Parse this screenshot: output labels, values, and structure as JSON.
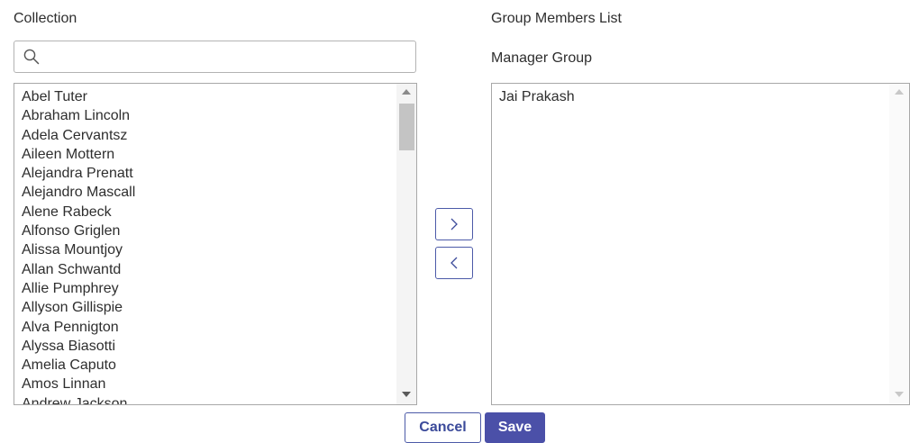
{
  "collection": {
    "heading": "Collection",
    "search_placeholder": "",
    "items": [
      "Abel Tuter",
      "Abraham Lincoln",
      "Adela Cervantsz",
      "Aileen Mottern",
      "Alejandra Prenatt",
      "Alejandro Mascall",
      "Alene Rabeck",
      "Alfonso Griglen",
      "Alissa Mountjoy",
      "Allan Schwantd",
      "Allie Pumphrey",
      "Allyson Gillispie",
      "Alva Pennigton",
      "Alyssa Biasotti",
      "Amelia Caputo",
      "Amos Linnan",
      "Andrew Jackson"
    ]
  },
  "members": {
    "heading": "Group Members List",
    "group_name": "Manager Group",
    "items": [
      "Jai Prakash"
    ]
  },
  "buttons": {
    "cancel": "Cancel",
    "save": "Save"
  },
  "colors": {
    "accent": "#4b50a8",
    "border": "#a8a8a8"
  },
  "icons": {
    "search": "search-icon",
    "add": "chevron-right-icon",
    "remove": "chevron-left-icon"
  }
}
